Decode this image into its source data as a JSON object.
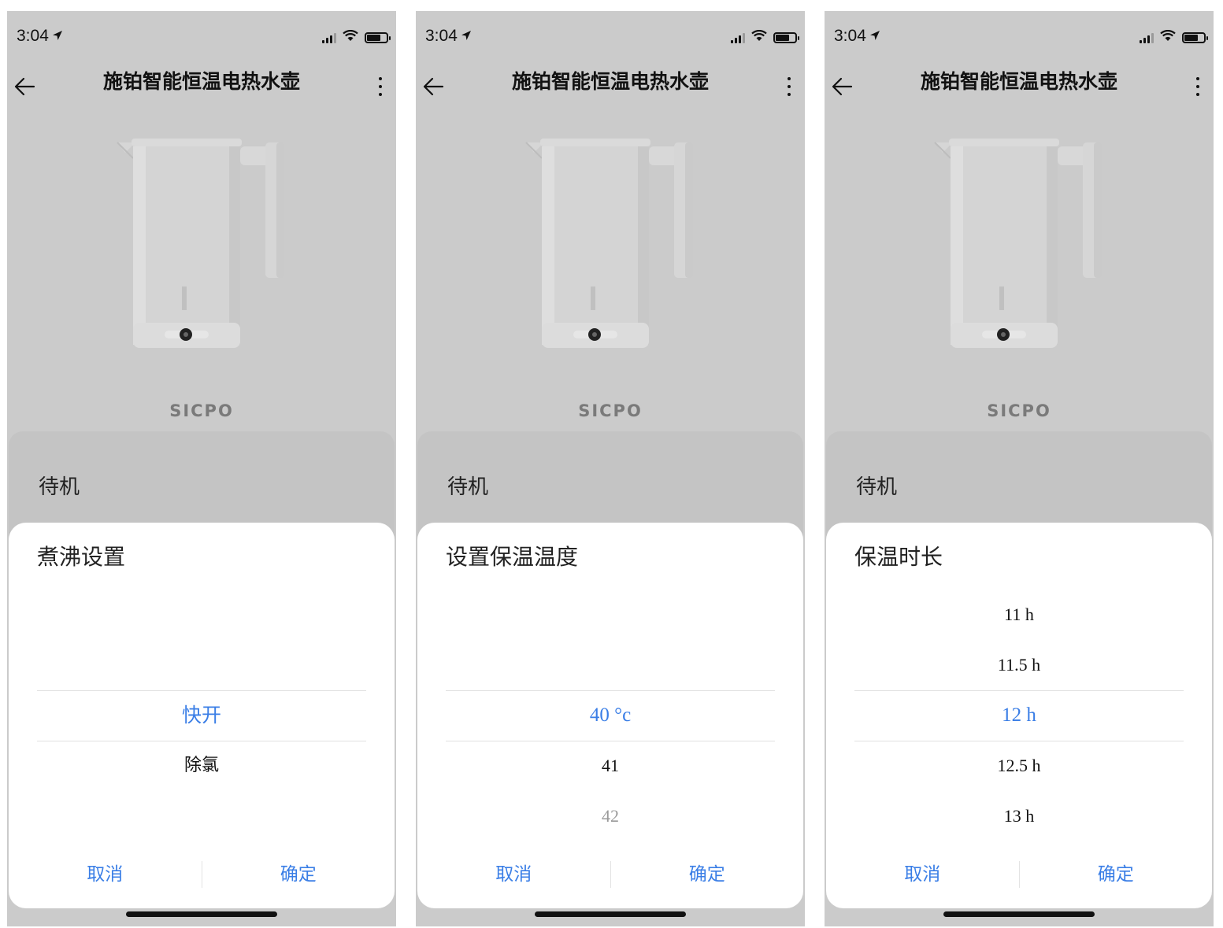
{
  "status_bar": {
    "time": "3:04"
  },
  "nav": {
    "title": "施铂智能恒温电热水壶"
  },
  "brand": "SICPO",
  "device_state": "待机",
  "colors": {
    "accent": "#3a7ee6",
    "backdrop": "#cbcbcb"
  },
  "screens": [
    {
      "sheet_title": "煮沸设置",
      "items": [
        {
          "label": "快开",
          "state": "selected"
        },
        {
          "label": "除氯",
          "state": "normal"
        }
      ]
    },
    {
      "sheet_title": "设置保温温度",
      "items": [
        {
          "label": "40 °c",
          "state": "selected"
        },
        {
          "label": "41",
          "state": "normal"
        },
        {
          "label": "42",
          "state": "faded"
        }
      ]
    },
    {
      "sheet_title": "保温时长",
      "items": [
        {
          "label": "11 h",
          "state": "normal"
        },
        {
          "label": "11.5 h",
          "state": "normal"
        },
        {
          "label": "12 h",
          "state": "selected"
        },
        {
          "label": "12.5 h",
          "state": "normal"
        },
        {
          "label": "13 h",
          "state": "normal"
        }
      ]
    }
  ],
  "actions": {
    "cancel": "取消",
    "confirm": "确定"
  },
  "icons": {
    "back": "back-arrow-icon",
    "more": "more-vertical-icon",
    "location": "location-arrow-icon"
  }
}
